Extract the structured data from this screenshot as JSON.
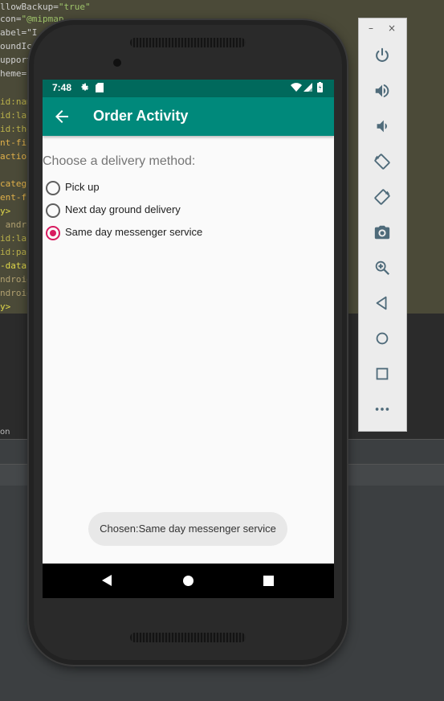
{
  "ide": {
    "code_lines": [
      {
        "text": "llowBackup=",
        "str": "\"true\""
      },
      {
        "text": "con=",
        "str": "\"@mipmap"
      },
      {
        "text": "abel=\"I",
        "str": ""
      },
      {
        "text": "oundIc",
        "str": ""
      },
      {
        "text": "upport",
        "str": ""
      },
      {
        "text": "heme=",
        "str": "\""
      },
      {
        "text": "",
        "str": ""
      },
      {
        "text": "id:nam",
        "str": ""
      },
      {
        "text": "id:lab",
        "str": ""
      },
      {
        "text": "id:the",
        "str": ""
      },
      {
        "text": "nt-fil",
        "str": ""
      },
      {
        "text": "action",
        "str": ""
      },
      {
        "text": "",
        "str": ""
      },
      {
        "text": "catego",
        "str": ""
      },
      {
        "text": "ent-fi",
        "str": ""
      },
      {
        "text": "y>",
        "str": ""
      },
      {
        "text": " andro",
        "str": ""
      },
      {
        "text": "id:lab",
        "str": ""
      },
      {
        "text": "id:par",
        "str": ""
      },
      {
        "text": "-data",
        "str": ""
      },
      {
        "text": "ndroid",
        "str": ""
      },
      {
        "text": "ndroid",
        "str": ""
      },
      {
        "text": "y>",
        "str": ""
      },
      {
        "text": ">",
        "str": ""
      }
    ],
    "bottom_tab_label": "on"
  },
  "status_bar": {
    "time": "7:48"
  },
  "app_bar": {
    "title": "Order Activity"
  },
  "content": {
    "prompt": "Choose a delivery method:",
    "options": [
      {
        "label": "Pick up",
        "checked": false
      },
      {
        "label": "Next day ground delivery",
        "checked": false
      },
      {
        "label": "Same day messenger service",
        "checked": true
      }
    ]
  },
  "toast": {
    "text": "Chosen:Same day messenger service"
  },
  "emulator_panel": {
    "minimize_label": "–",
    "close_label": "×",
    "buttons": [
      "power-icon",
      "volume-up-icon",
      "volume-down-icon",
      "rotate-left-icon",
      "rotate-right-icon",
      "camera-icon",
      "zoom-icon",
      "back-icon",
      "home-icon",
      "overview-icon",
      "more-icon"
    ]
  },
  "colors": {
    "app_bar": "#00897b",
    "status_bar": "#00695c",
    "accent": "#d81b60"
  }
}
